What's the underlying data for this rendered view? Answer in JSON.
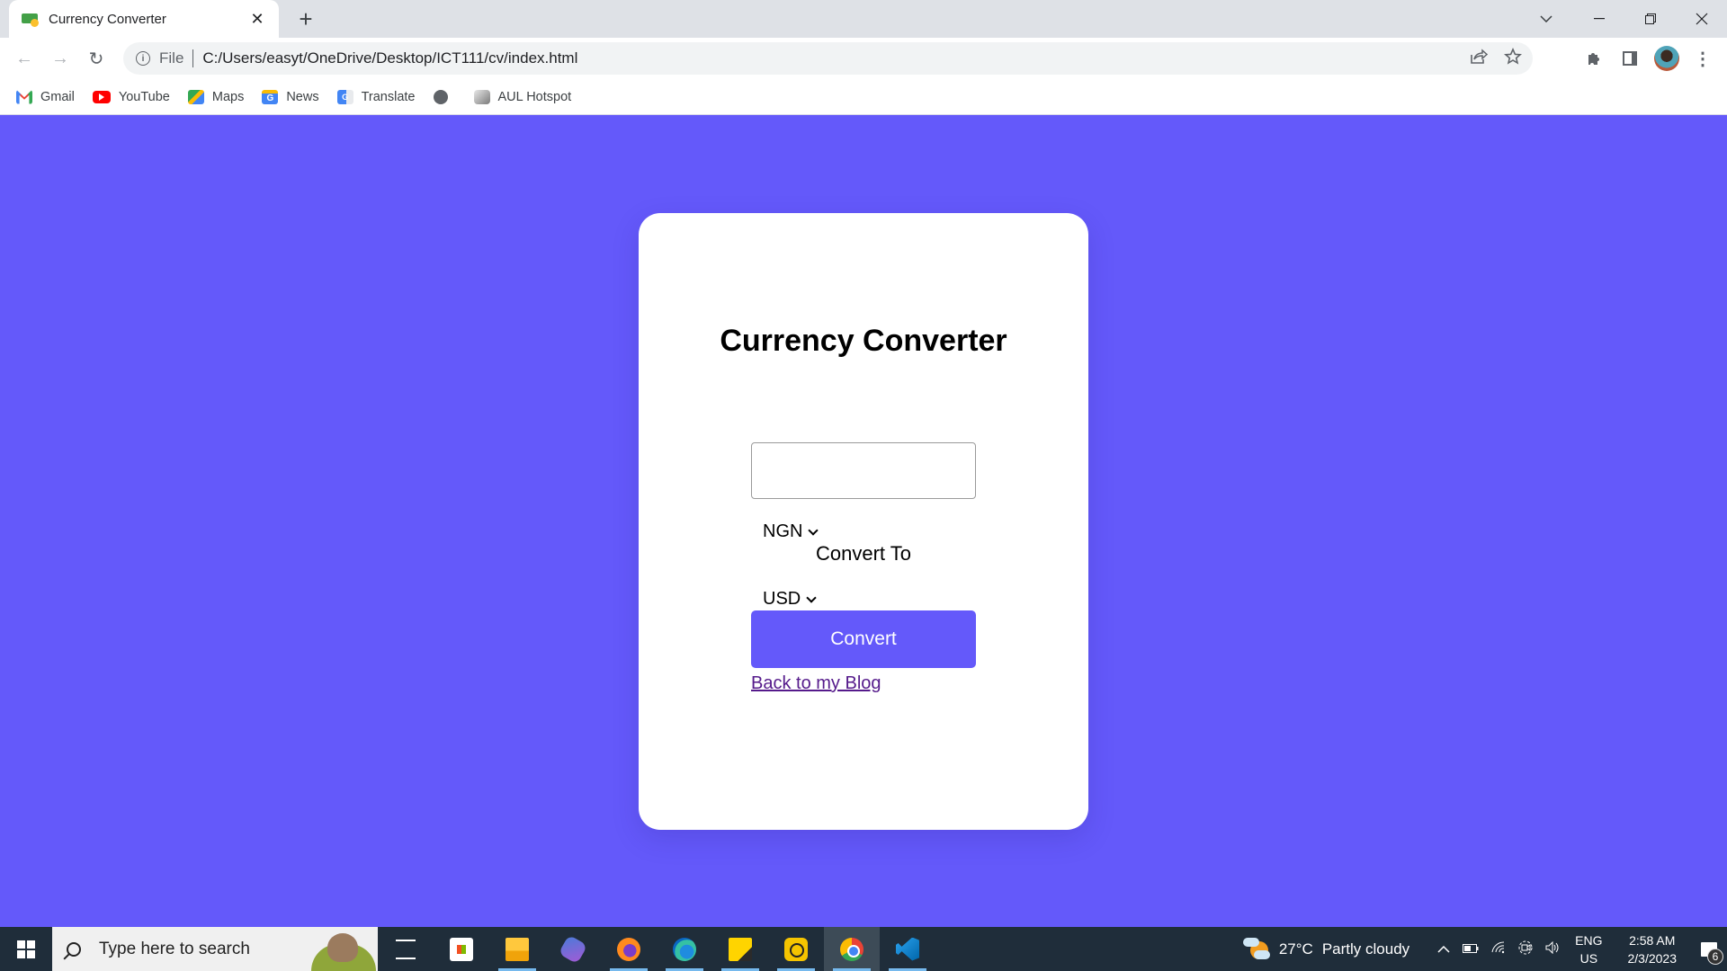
{
  "browser": {
    "tab": {
      "title": "Currency Converter",
      "favicon": "money-icon"
    },
    "new_tab_label": "+",
    "window_controls": {
      "tab_search": "⌄",
      "minimize": "—",
      "restore": "❐",
      "close": "✕"
    },
    "nav": {
      "back": "←",
      "forward": "→",
      "reload": "↻"
    },
    "omnibox": {
      "scheme_label": "File",
      "url": "C:/Users/easyt/OneDrive/Desktop/ICT111/cv/index.html"
    },
    "bookmarks": [
      {
        "label": "Gmail",
        "icon": "gmail-icon"
      },
      {
        "label": "YouTube",
        "icon": "youtube-icon"
      },
      {
        "label": "Maps",
        "icon": "maps-icon"
      },
      {
        "label": "News",
        "icon": "news-icon"
      },
      {
        "label": "Translate",
        "icon": "translate-icon"
      },
      {
        "label": "",
        "icon": "globe-icon"
      },
      {
        "label": "AUL Hotspot",
        "icon": "hotspot-icon"
      }
    ]
  },
  "page": {
    "background_color": "#6459fa",
    "title": "Currency Converter",
    "amount_input": {
      "value": "",
      "placeholder": ""
    },
    "from_currency": {
      "selected": "NGN"
    },
    "convert_to_label": "Convert To",
    "to_currency": {
      "selected": "USD"
    },
    "convert_button": "Convert",
    "back_link": "Back to my Blog",
    "link_color": "#551a8b"
  },
  "taskbar": {
    "search_placeholder": "Type here to search",
    "apps": [
      {
        "name": "task-view",
        "running": false
      },
      {
        "name": "microsoft-store",
        "running": false
      },
      {
        "name": "file-explorer",
        "running": true
      },
      {
        "name": "copilot",
        "running": false
      },
      {
        "name": "firefox",
        "running": true
      },
      {
        "name": "edge",
        "running": true
      },
      {
        "name": "sticky-notes",
        "running": true
      },
      {
        "name": "ldplayer",
        "running": true
      },
      {
        "name": "chrome",
        "running": true,
        "active": true
      },
      {
        "name": "vscode",
        "running": true
      }
    ],
    "weather": {
      "temperature": "27°C",
      "condition": "Partly cloudy"
    },
    "tray": {
      "chevron": "^",
      "battery": "▭",
      "wifi": "◠",
      "meet": "◫",
      "volume": "🔈"
    },
    "language": {
      "line1": "ENG",
      "line2": "US"
    },
    "clock": {
      "time": "2:58 AM",
      "date": "2/3/2023"
    },
    "notifications_count": "6"
  }
}
